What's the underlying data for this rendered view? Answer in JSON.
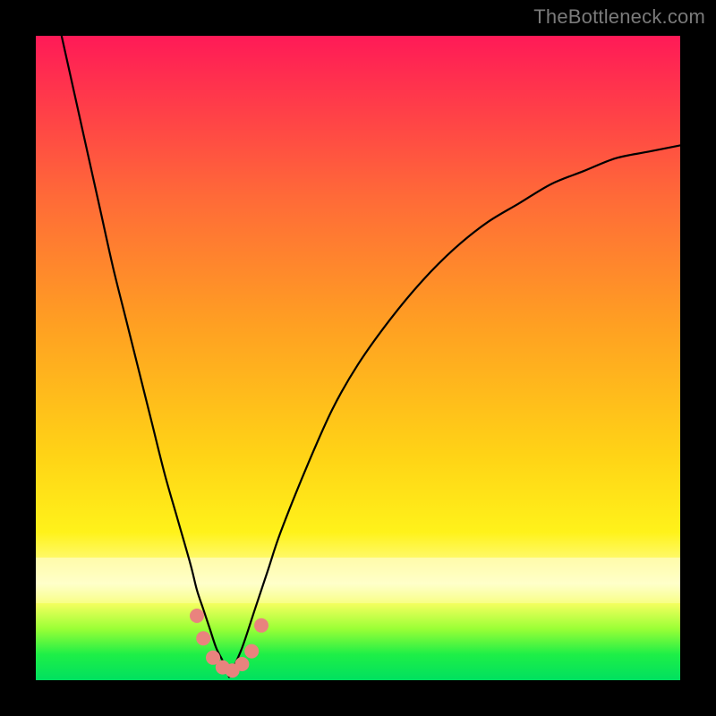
{
  "watermark": "TheBottleneck.com",
  "chart_data": {
    "type": "line",
    "title": "",
    "xlabel": "",
    "ylabel": "",
    "xlim": [
      0,
      100
    ],
    "ylim": [
      0,
      100
    ],
    "grid": false,
    "legend": false,
    "series": [
      {
        "name": "left-curve",
        "x": [
          4,
          6,
          8,
          10,
          12,
          14,
          16,
          18,
          20,
          22,
          24,
          25,
          26,
          27,
          28,
          29,
          30
        ],
        "y": [
          100,
          91,
          82,
          73,
          64,
          56,
          48,
          40,
          32,
          25,
          18,
          14,
          11,
          8,
          5,
          3,
          0.5
        ]
      },
      {
        "name": "right-curve",
        "x": [
          30,
          32,
          34,
          36,
          38,
          42,
          46,
          50,
          55,
          60,
          65,
          70,
          75,
          80,
          85,
          90,
          95,
          100
        ],
        "y": [
          0.5,
          5,
          11,
          17,
          23,
          33,
          42,
          49,
          56,
          62,
          67,
          71,
          74,
          77,
          79,
          81,
          82,
          83
        ]
      }
    ],
    "markers": {
      "name": "bottom-dots",
      "color": "#e9837e",
      "points": [
        {
          "x": 25.0,
          "y": 10.0
        },
        {
          "x": 26.0,
          "y": 6.5
        },
        {
          "x": 27.5,
          "y": 3.5
        },
        {
          "x": 29.0,
          "y": 2.0
        },
        {
          "x": 30.5,
          "y": 1.5
        },
        {
          "x": 32.0,
          "y": 2.5
        },
        {
          "x": 33.5,
          "y": 4.5
        },
        {
          "x": 35.0,
          "y": 8.5
        }
      ]
    },
    "gradient_stops": [
      {
        "pos": 0,
        "color": "#ff1a57"
      },
      {
        "pos": 25,
        "color": "#ff6a38"
      },
      {
        "pos": 65,
        "color": "#ffd316"
      },
      {
        "pos": 85,
        "color": "#ffffb0"
      },
      {
        "pos": 100,
        "color": "#00e060"
      }
    ]
  }
}
